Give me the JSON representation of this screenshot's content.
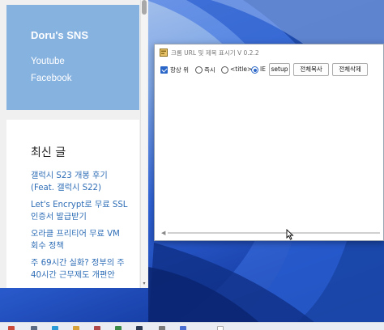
{
  "browser": {
    "site_title": "Doru's SNS",
    "nav": [
      "Youtube",
      "Facebook"
    ],
    "widget_title": "최신 글",
    "posts": [
      "갤럭시 S23 개봉 후기 (Feat. 갤럭시 S22)",
      "Let's Encrypt로 무료 SSL 인증서 발급받기",
      "오라클 프리티어 무료 VM 회수 정책",
      "주 69시간 실화? 정부의 주40시간 근무제도 개편안"
    ]
  },
  "app": {
    "title": "크롬 URL 및 제목 표시기  V 0.2.2",
    "always_on_top_label": "항상 위",
    "options": [
      "즉시",
      "<title>",
      "IE"
    ],
    "selected_option": "IE",
    "buttons": {
      "setup": "setup",
      "copy_all": "전체복사",
      "delete_all": "전체삭제"
    }
  },
  "colors": {
    "blog_header": "#86b2e0",
    "link": "#2e6db6",
    "accent": "#2a66c8"
  },
  "icons": [
    "app-icon",
    "checkbox-checked",
    "radio-selected",
    "mouse-pointer-icon"
  ]
}
